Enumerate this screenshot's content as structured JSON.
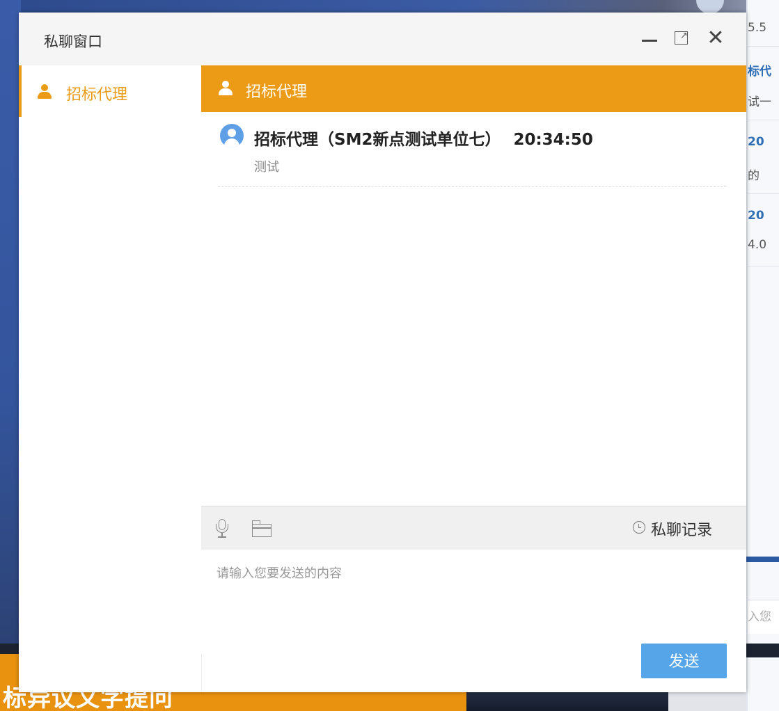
{
  "background": {
    "banner_text": "标异议文字提问",
    "right_panel": {
      "rows": [
        {
          "text": "5.5",
          "style": "gray"
        },
        {
          "text": "标代",
          "style": "blue"
        },
        {
          "text": "试一",
          "style": "gray"
        },
        {
          "text": "20",
          "style": "blue"
        },
        {
          "text": "的 ",
          "style": "gray"
        },
        {
          "text": "20",
          "style": "blue"
        },
        {
          "text": "4.0",
          "style": "gray"
        }
      ],
      "input_fragment": "入您"
    }
  },
  "dialog": {
    "title": "私聊窗口",
    "controls": {
      "minimize": "minimize-icon",
      "maximize": "maximize-icon",
      "close": "close-icon",
      "close_glyph": "✕"
    }
  },
  "contacts": [
    {
      "name": "招标代理",
      "icon": "person-icon",
      "active": true
    }
  ],
  "chat": {
    "header_title": "招标代理",
    "messages": [
      {
        "sender": "招标代理（SM2新点测试单位七）",
        "time": "20:34:50",
        "text": "测试",
        "avatar": "user-avatar-icon"
      }
    ]
  },
  "toolbar": {
    "voice_icon": "microphone-icon",
    "file_icon": "folder-icon",
    "history_label": "私聊记录",
    "history_icon": "clock-icon"
  },
  "input": {
    "value": "",
    "placeholder": "请输入您要发送的内容"
  },
  "send_button": {
    "label": "发送"
  },
  "colors": {
    "accent": "#eb9b16",
    "send": "#56a5e8",
    "avatar": "#5e9fe6"
  }
}
